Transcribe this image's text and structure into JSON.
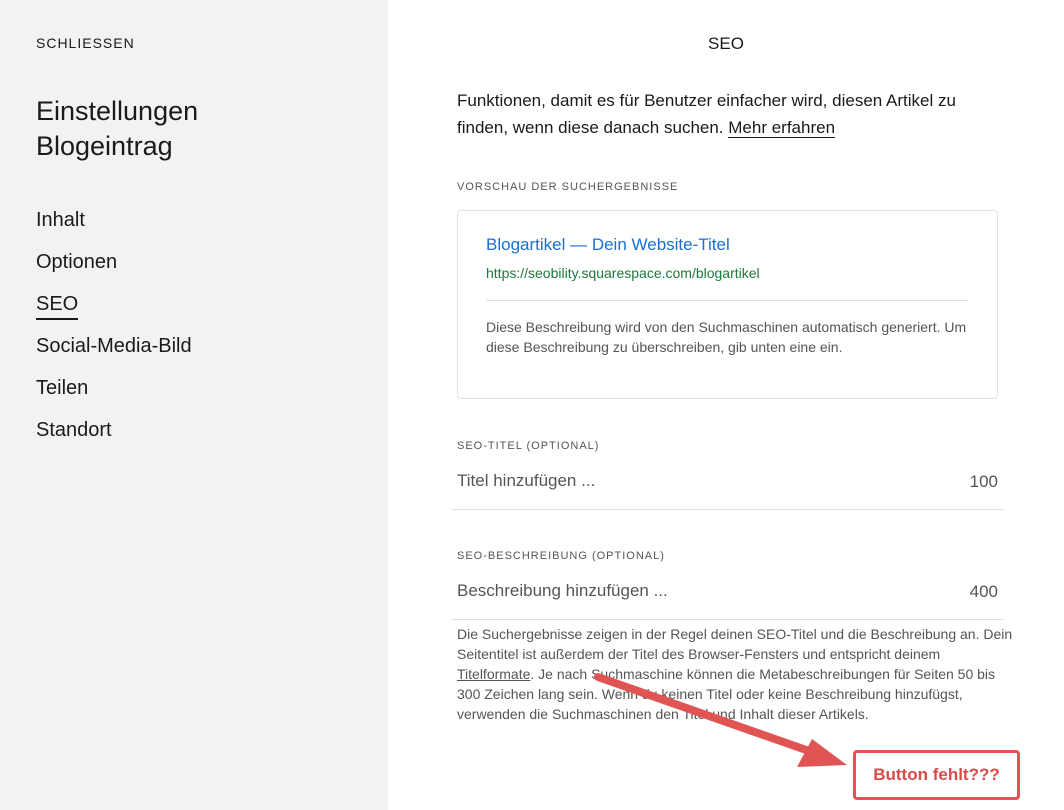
{
  "sidebar": {
    "close_label": "SCHLIESSEN",
    "title_line1": "Einstellungen",
    "title_line2": "Blogeintrag",
    "nav": [
      "Inhalt",
      "Optionen",
      "SEO",
      "Social-Media-Bild",
      "Teilen",
      "Standort"
    ],
    "active_item": "SEO"
  },
  "main": {
    "title": "SEO",
    "intro_text": "Funktionen, damit es für Benutzer einfacher wird, diesen Artikel zu finden, wenn diese danach suchen.",
    "intro_link": "Mehr erfahren",
    "preview": {
      "label": "VORSCHAU DER SUCHERGEBNISSE",
      "title": "Blogartikel — Dein Website-Titel",
      "url": "https://seobility.squarespace.com/blogartikel",
      "description": "Diese Beschreibung wird von den Suchmaschinen automatisch generiert. Um diese Beschreibung zu überschreiben, gib unten eine ein."
    },
    "seo_title": {
      "label": "SEO-TITEL (OPTIONAL)",
      "placeholder": "Titel hinzufügen ...",
      "value": "",
      "remaining": "100"
    },
    "seo_description": {
      "label": "SEO-BESCHREIBUNG (OPTIONAL)",
      "placeholder": "Beschreibung hinzufügen ...",
      "value": "",
      "remaining": "400"
    },
    "help": {
      "text_before": "Die Suchergebnisse zeigen in der Regel deinen SEO-Titel und die Beschreibung an. Dein Seitentitel ist außerdem der Titel des Browser-Fensters und entspricht deinem ",
      "link": "Titelformate",
      "text_after": ". Je nach Suchmaschine können die Metabeschreibungen für Seiten 50 bis 300 Zeichen lang sein. Wenn du keinen Titel oder keine Beschreibung hinzufügst, verwenden die Suchmaschinen den Titel und Inhalt dieser Artikels."
    }
  },
  "annotation": {
    "text": "Button fehlt???",
    "color": "#e05553"
  }
}
